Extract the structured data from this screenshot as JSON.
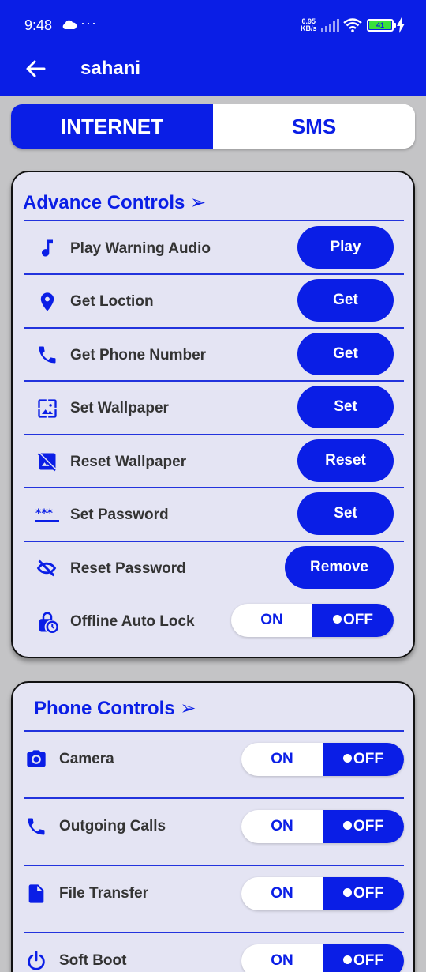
{
  "status_bar": {
    "time": "9:48",
    "more": "···",
    "net_speed_value": "0.95",
    "net_speed_unit": "KB/s",
    "battery_level": "41"
  },
  "header": {
    "title": "sahani"
  },
  "tabs": {
    "internet": "INTERNET",
    "sms": "SMS"
  },
  "advance": {
    "title": "Advance Controls ➢",
    "rows": [
      {
        "label": "Play Warning Audio",
        "button": "Play",
        "icon": "music-note-icon"
      },
      {
        "label": "Get Loction",
        "button": "Get",
        "icon": "location-pin-icon"
      },
      {
        "label": "Get Phone Number",
        "button": "Get",
        "icon": "phone-icon"
      },
      {
        "label": "Set Wallpaper",
        "button": "Set",
        "icon": "wallpaper-icon"
      },
      {
        "label": "Reset Wallpaper",
        "button": "Reset",
        "icon": "no-image-icon"
      },
      {
        "label": "Set Password",
        "button": "Set",
        "icon": "password-icon"
      },
      {
        "label": "Reset Password",
        "button": "Remove",
        "icon": "hide-password-icon"
      }
    ],
    "offline_lock": {
      "label": "Offline Auto Lock",
      "on": "ON",
      "off": "OFF",
      "state": "OFF",
      "icon": "lock-clock-icon"
    }
  },
  "phone": {
    "title": "Phone Controls ➢",
    "rows": [
      {
        "label": "Camera",
        "on": "ON",
        "off": "OFF",
        "state": "OFF",
        "icon": "camera-icon"
      },
      {
        "label": "Outgoing Calls",
        "on": "ON",
        "off": "OFF",
        "state": "OFF",
        "icon": "phone-icon"
      },
      {
        "label": "File Transfer",
        "on": "ON",
        "off": "OFF",
        "state": "OFF",
        "icon": "file-icon"
      },
      {
        "label": "Soft Boot",
        "on": "ON",
        "off": "OFF",
        "state": "OFF",
        "icon": "power-icon"
      }
    ]
  },
  "colors": {
    "primary": "#0a1ee6",
    "card_bg": "#e4e4f3",
    "page_bg": "#c4c4c6",
    "battery": "#3be23b"
  }
}
